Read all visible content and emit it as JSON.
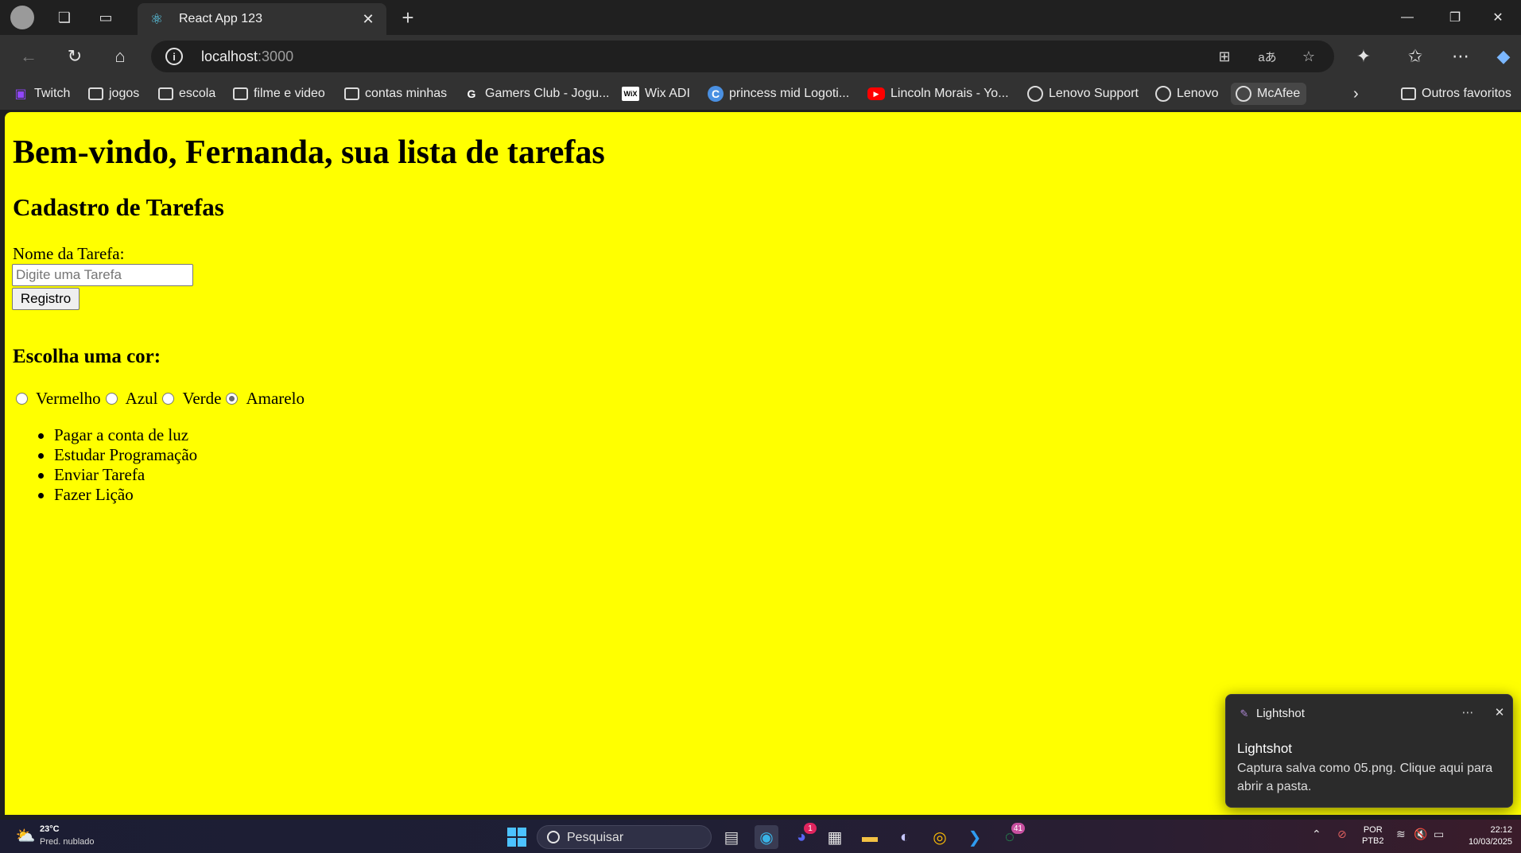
{
  "browser": {
    "tab_title": "React App 123",
    "url_host": "localhost",
    "url_port": ":3000"
  },
  "bookmarks": [
    {
      "label": "Twitch",
      "icon": "twitch-icon"
    },
    {
      "label": "jogos",
      "icon": "folder-icon"
    },
    {
      "label": "escola",
      "icon": "folder-icon"
    },
    {
      "label": "filme e video",
      "icon": "folder-icon"
    },
    {
      "label": "contas minhas",
      "icon": "folder-icon"
    },
    {
      "label": "Gamers Club - Jogu...",
      "icon": "gamersclub-icon"
    },
    {
      "label": "Wix ADI",
      "icon": "wix-icon"
    },
    {
      "label": "princess mid Logoti...",
      "icon": "canva-icon"
    },
    {
      "label": "Lincoln Morais - Yo...",
      "icon": "youtube-icon"
    },
    {
      "label": "Lenovo Support",
      "icon": "globe-icon"
    },
    {
      "label": "Lenovo",
      "icon": "globe-icon"
    },
    {
      "label": "McAfee",
      "icon": "globe-icon"
    }
  ],
  "other_favorites": "Outros favoritos",
  "page": {
    "welcome": "Bem-vindo, Fernanda, sua lista de tarefas",
    "form_title": "Cadastro de Tarefas",
    "task_label": "Nome da Tarefa:",
    "task_placeholder": "Digite uma Tarefa",
    "task_value": "",
    "register_button": "Registro",
    "color_title": "Escolha uma cor:",
    "colors": [
      {
        "label": "Vermelho",
        "checked": false
      },
      {
        "label": "Azul",
        "checked": false
      },
      {
        "label": "Verde",
        "checked": false
      },
      {
        "label": "Amarelo",
        "checked": true
      }
    ],
    "background_color": "#ffff00",
    "tasks": [
      "Pagar a conta de luz",
      "Estudar Programação",
      "Enviar Tarefa",
      "Fazer Lição"
    ]
  },
  "toast": {
    "app_name": "Lightshot",
    "title": "Lightshot",
    "body": "Captura salva como 05.png. Clique aqui para abrir a pasta."
  },
  "taskbar": {
    "weather_temp": "23°C",
    "weather_desc": "Pred. nublado",
    "search_label": "Pesquisar",
    "discord_badge": "1",
    "whatsapp_badge": "41",
    "lang_1": "POR",
    "lang_2": "PTB2",
    "time": "22:12",
    "date": "10/03/2025"
  }
}
